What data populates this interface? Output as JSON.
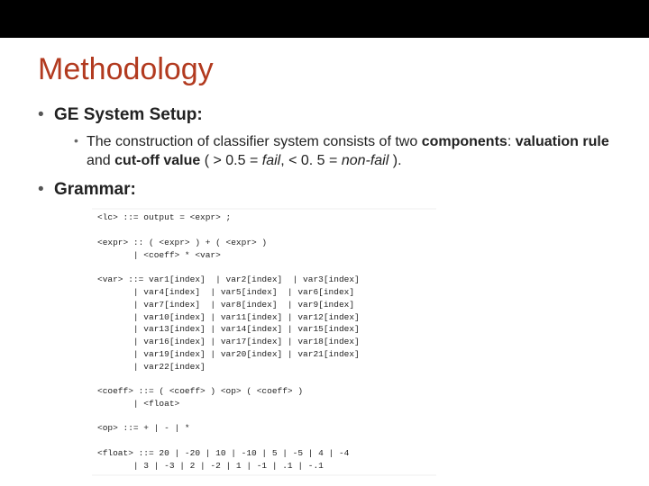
{
  "title": "Methodology",
  "bullets": {
    "b1_label": "GE System Setup:",
    "b1_sub_pre": "The construction of classifier system consists of two ",
    "b1_sub_components": "components",
    "b1_sub_colon": ": ",
    "b1_sub_valuation": "valuation rule",
    "b1_sub_and": " and ",
    "b1_sub_cutoff": "cut-off value",
    "b1_sub_open": " ( > 0.5 = ",
    "b1_sub_fail": "fail",
    "b1_sub_mid": ", < 0. 5 = ",
    "b1_sub_nonfail": "non-fail",
    "b1_sub_close": " ).",
    "b2_label": "Grammar:"
  },
  "grammar": "<lc> ::= output = <expr> ;\n\n<expr> :: ( <expr> ) + ( <expr> )\n       | <coeff> * <var>\n\n<var> ::= var1[index]  | var2[index]  | var3[index]\n       | var4[index]  | var5[index]  | var6[index]\n       | var7[index]  | var8[index]  | var9[index]\n       | var10[index] | var11[index] | var12[index]\n       | var13[index] | var14[index] | var15[index]\n       | var16[index] | var17[index] | var18[index]\n       | var19[index] | var20[index] | var21[index]\n       | var22[index]\n\n<coeff> ::= ( <coeff> ) <op> ( <coeff> )\n       | <float>\n\n<op> ::= + | - | *\n\n<float> ::= 20 | -20 | 10 | -10 | 5 | -5 | 4 | -4\n       | 3 | -3 | 2 | -2 | 1 | -1 | .1 | -.1"
}
